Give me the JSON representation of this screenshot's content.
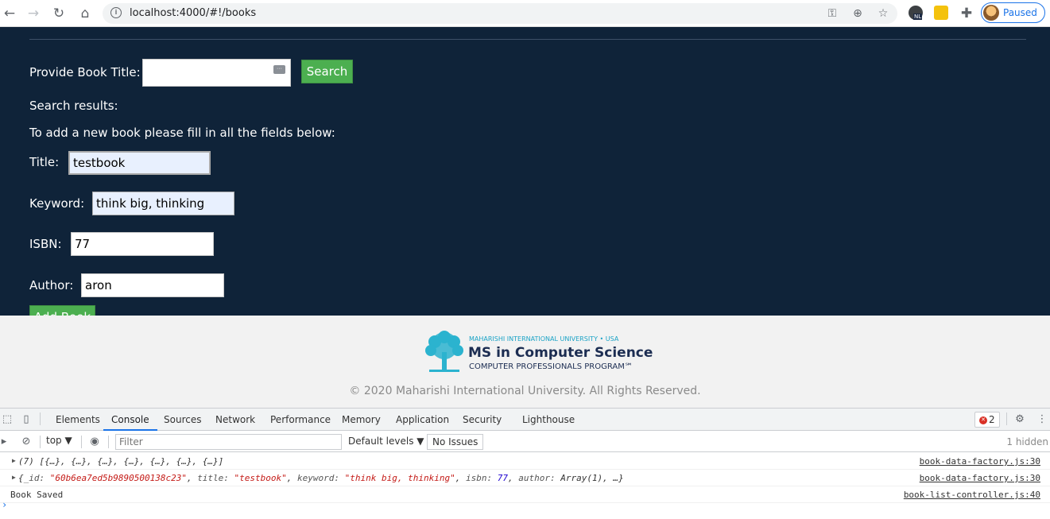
{
  "browser": {
    "url": "localhost:4000/#!/books",
    "profile_label": "Paused",
    "ext_badge": "NL"
  },
  "page": {
    "search_label": "Provide Book Title:",
    "search_value": "",
    "search_button": "Search",
    "results_label": "Search results:",
    "add_instructions": "To add a new book please fill in all the fields below:",
    "fields": {
      "title_label": "Title:",
      "title_value": "testbook",
      "keyword_label": "Keyword:",
      "keyword_value": "think big, thinking",
      "isbn_label": "ISBN:",
      "isbn_value": "77",
      "author_label": "Author:",
      "author_value": "aron"
    },
    "add_button": "Add Book",
    "colors": {
      "background": "#0f2339",
      "button": "#4caf50"
    }
  },
  "footer": {
    "logo_line1": "MAHARISHI INTERNATIONAL UNIVERSITY • USA",
    "logo_line2": "MS in Computer Science",
    "logo_line3": "COMPUTER PROFESSIONALS PROGRAM℠",
    "copyright": "© 2020 Maharishi International University. All Rights Reserved."
  },
  "devtools": {
    "tabs": [
      "Elements",
      "Console",
      "Sources",
      "Network",
      "Performance",
      "Memory",
      "Application",
      "Security",
      "Lighthouse"
    ],
    "active_tab": "Console",
    "error_count": "2",
    "context": "top",
    "filter_placeholder": "Filter",
    "levels": "Default levels",
    "issues": "No Issues",
    "hidden": "1 hidden",
    "logs": [
      {
        "text": "(7) [{…}, {…}, {…}, {…}, {…}, {…}, {…}]",
        "source": "book-data-factory.js:30"
      },
      {
        "id_value": "\"60b6ea7ed5b9890500138c23\"",
        "title_value": "\"testbook\"",
        "keyword_value": "\"think big, thinking\"",
        "isbn_value": "77",
        "author_value": "Array(1), …",
        "source": "book-data-factory.js:30"
      },
      {
        "text": "Book Saved",
        "source": "book-list-controller.js:40"
      }
    ]
  }
}
